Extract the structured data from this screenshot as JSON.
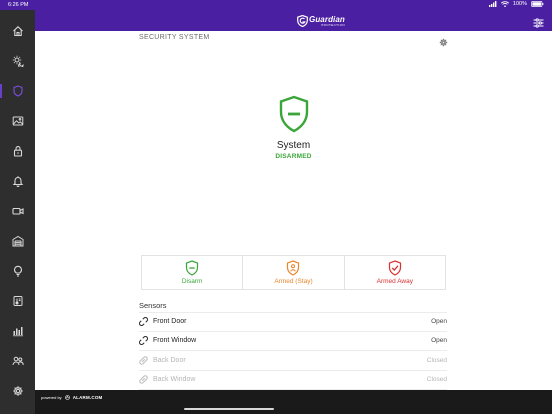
{
  "status_bar": {
    "time": "6:26 PM",
    "battery": "100%"
  },
  "brand": {
    "name": "Guardian",
    "tagline": "PROTECTION"
  },
  "sidebar": {
    "items": [
      {
        "name": "home",
        "icon": "home-icon",
        "active": false
      },
      {
        "name": "energy",
        "icon": "sun-moon-icon",
        "active": false
      },
      {
        "name": "security",
        "icon": "shield-icon",
        "active": true
      },
      {
        "name": "images",
        "icon": "image-icon",
        "active": false
      },
      {
        "name": "locks",
        "icon": "lock-icon",
        "active": false
      },
      {
        "name": "notifications",
        "icon": "bell-icon",
        "active": false
      },
      {
        "name": "video",
        "icon": "video-camera-icon",
        "active": false
      },
      {
        "name": "garage",
        "icon": "garage-icon",
        "active": false
      },
      {
        "name": "lights",
        "icon": "lightbulb-icon",
        "active": false
      },
      {
        "name": "thermostat",
        "icon": "thermostat-icon",
        "active": false
      },
      {
        "name": "reports",
        "icon": "bar-chart-icon",
        "active": false
      },
      {
        "name": "users",
        "icon": "users-icon",
        "active": false
      },
      {
        "name": "settings",
        "icon": "gear-icon",
        "active": false
      }
    ]
  },
  "page": {
    "section_title": "SECURITY SYSTEM"
  },
  "system": {
    "label": "System",
    "status": "DISARMED"
  },
  "arming": {
    "disarm": {
      "label": "Disarm",
      "color": "#3aa63a"
    },
    "stay": {
      "label": "Armed (Stay)",
      "color": "#e8862a"
    },
    "away": {
      "label": "Armed Away",
      "color": "#d93030"
    }
  },
  "sensors": {
    "title": "Sensors",
    "items": [
      {
        "name": "Front Door",
        "state": "Open",
        "icon": "link-open-icon",
        "dim": false
      },
      {
        "name": "Front Window",
        "state": "Open",
        "icon": "link-open-icon",
        "dim": false
      },
      {
        "name": "Back Door",
        "state": "Closed",
        "icon": "link-closed-icon",
        "dim": true
      },
      {
        "name": "Back Window",
        "state": "Closed",
        "icon": "link-closed-icon",
        "dim": true
      }
    ]
  },
  "footer": {
    "powered_by": "powered by",
    "provider": "ALARM.COM"
  },
  "colors": {
    "brand_purple": "#4b1fa1",
    "sidebar": "#2e2e2e",
    "disarmed_green": "#3aa63a"
  }
}
